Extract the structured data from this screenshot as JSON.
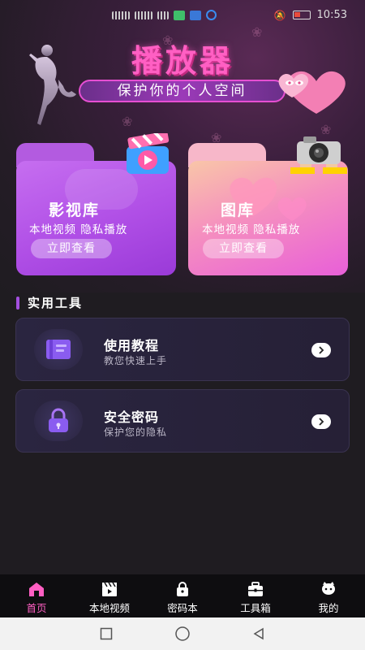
{
  "status_bar": {
    "time": "10:53",
    "battery_level": "14"
  },
  "header": {
    "title": "播放器",
    "slogan": "保护你的个人空间"
  },
  "cards": [
    {
      "title": "影视库",
      "subtitle": "本地视频  隐私播放",
      "button": "立即查看"
    },
    {
      "title": "图库",
      "subtitle": "本地视频  隐私播放",
      "button": "立即查看"
    }
  ],
  "tools_section": {
    "title": "实用工具",
    "items": [
      {
        "name": "使用教程",
        "desc": "教您快速上手",
        "icon": "book-icon"
      },
      {
        "name": "安全密码",
        "desc": "保护您的隐私",
        "icon": "lock-icon"
      }
    ]
  },
  "bottom_nav": {
    "items": [
      {
        "label": "首页",
        "icon": "home-icon",
        "active": true
      },
      {
        "label": "本地视频",
        "icon": "clapper-icon",
        "active": false
      },
      {
        "label": "密码本",
        "icon": "lock-icon",
        "active": false
      },
      {
        "label": "工具箱",
        "icon": "toolbox-icon",
        "active": false
      },
      {
        "label": "我的",
        "icon": "profile-icon",
        "active": false
      }
    ]
  },
  "colors": {
    "accent": "#ff5fc3",
    "purple": "#a34fe0",
    "background": "#1f1c21"
  }
}
